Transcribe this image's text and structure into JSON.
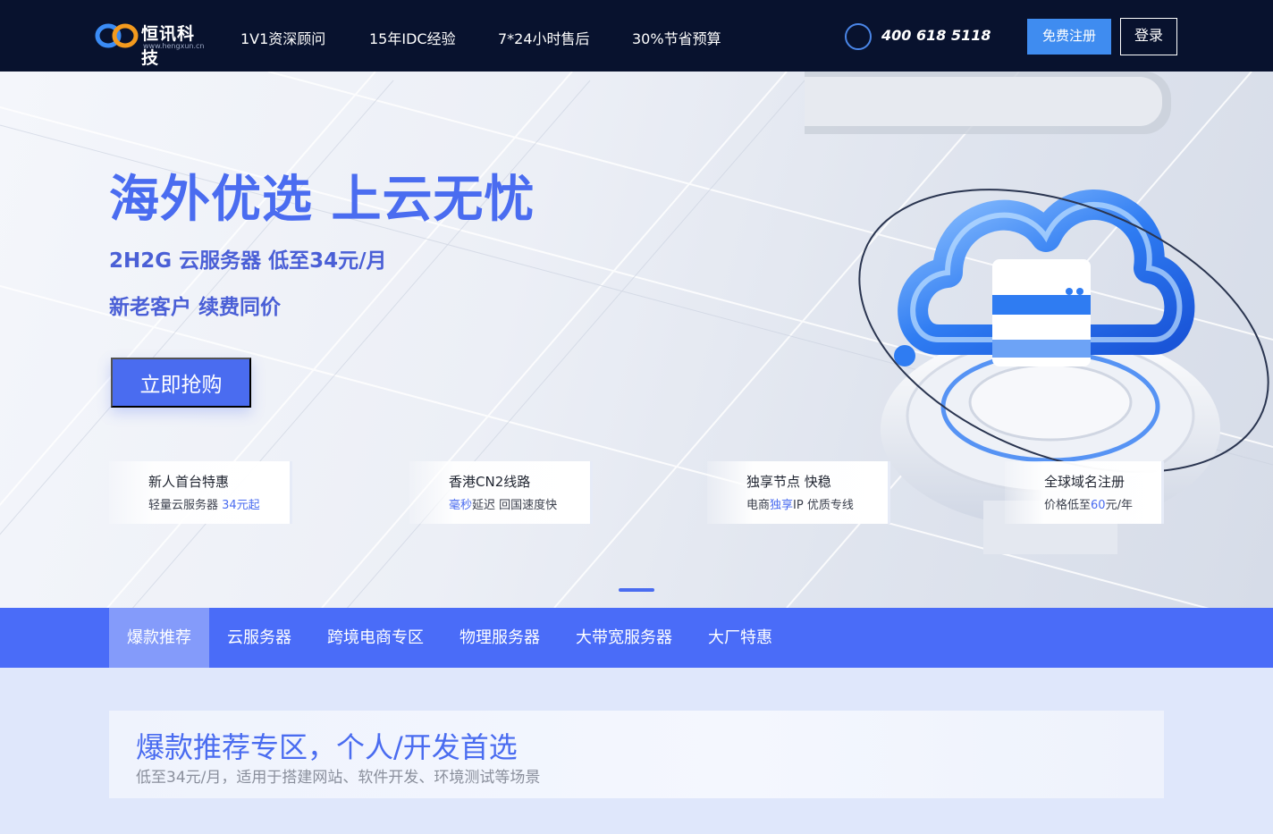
{
  "header": {
    "logo_text": "恒讯科技",
    "logo_sub": "www.hengxun.cn",
    "nav": [
      "1V1资深顾问",
      "15年IDC经验",
      "7*24小时售后",
      "30%节省预算"
    ],
    "phone": "400 618 5118",
    "register_label": "免费注册",
    "login_label": "登录"
  },
  "hero": {
    "title": "海外优选 上云无忧",
    "sub1": "2H2G 云服务器 低至34元/月",
    "sub2": "新老客户 续费同价",
    "cta_label": "立即抢购",
    "cards": [
      {
        "title": "新人首台特惠",
        "desc_pre": "轻量云服务器 ",
        "desc_hl": "34元起",
        "desc_post": ""
      },
      {
        "title": "香港CN2线路",
        "desc_pre": "",
        "desc_hl": "毫秒",
        "desc_post": "延迟 回国速度快"
      },
      {
        "title": "独享节点 快稳",
        "desc_pre": "电商",
        "desc_hl": "独享",
        "desc_post": "IP 优质专线"
      },
      {
        "title": "全球域名注册",
        "desc_pre": "价格低至",
        "desc_hl": "60",
        "desc_post": "元/年"
      }
    ]
  },
  "tabs": [
    "爆款推荐",
    "云服务器",
    "跨境电商专区",
    "物理服务器",
    "大带宽服务器",
    "大厂特惠"
  ],
  "active_tab": 0,
  "section": {
    "title": "爆款推荐专区，个人/开发首选",
    "subtitle": "低至34元/月，适用于搭建网站、软件开发、环境测试等场景"
  },
  "colors": {
    "header_bg": "#08122e",
    "accent": "#4a6cf0",
    "register_bg": "#3f8cf0",
    "tab_bar": "#4a6cf8"
  },
  "icons": [
    "logo-mark-icon",
    "phone-icon"
  ]
}
